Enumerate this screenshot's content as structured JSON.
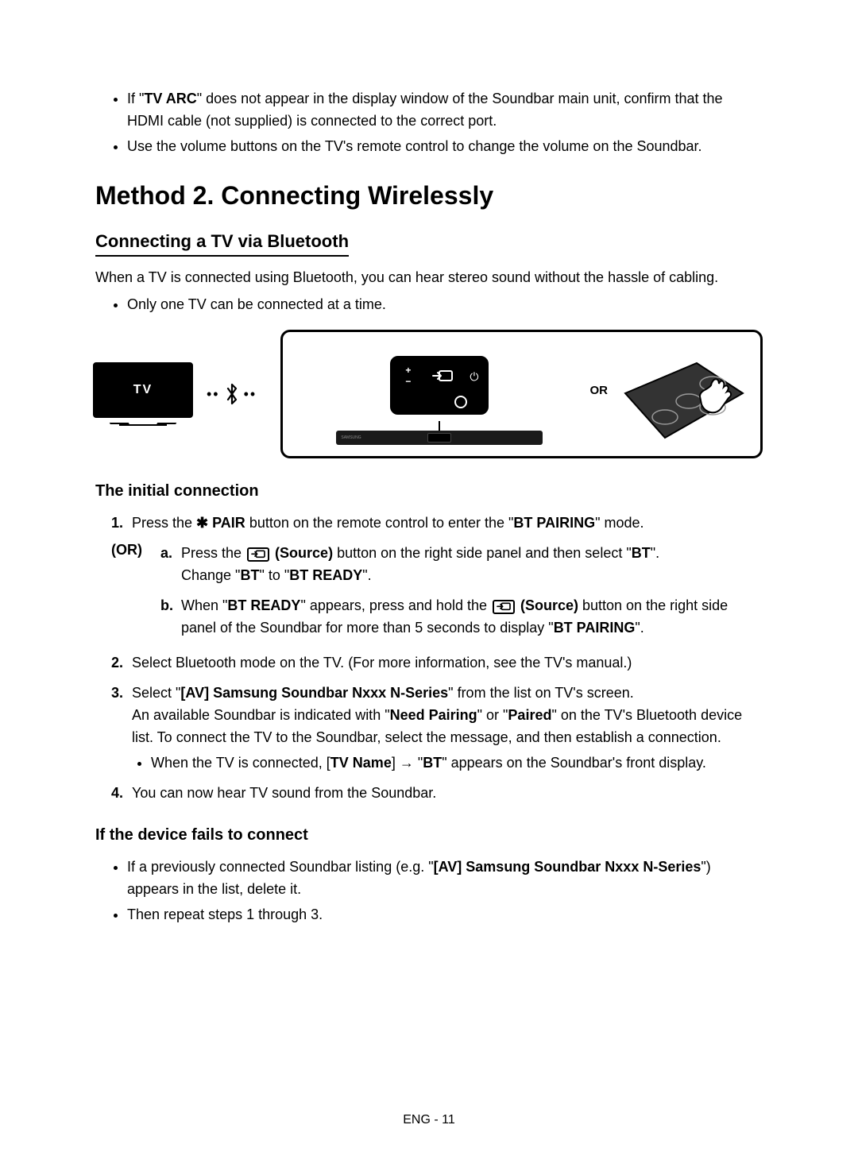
{
  "intro": {
    "bullets": [
      {
        "pre": "If \"",
        "bold": "TV ARC",
        "post": "\" does not appear in the display window of the Soundbar main unit, confirm that the HDMI cable (not supplied) is connected to the correct port."
      },
      {
        "plain": "Use the volume buttons on the TV's remote control to change the volume on the Soundbar."
      }
    ]
  },
  "method_heading": "Method 2. Connecting Wirelessly",
  "subheading": "Connecting a TV via Bluetooth",
  "desc": "When a TV is connected using Bluetooth, you can hear stereo sound without the hassle of cabling.",
  "desc_bullet": "Only one TV can be connected at a time.",
  "diagram": {
    "tv_label": "TV",
    "or_label": "OR",
    "soundbar_brand": "SAMSUNG",
    "remote_plus": "+",
    "remote_minus": "−",
    "remote_power": "⏻"
  },
  "initial_heading": "The initial connection",
  "step1": {
    "pre": "Press the ",
    "bt": "✱",
    "pair": " PAIR",
    "mid": " button on the remote control to enter the \"",
    "bold2": "BT PAIRING",
    "post": "\" mode."
  },
  "or_label": "(OR)",
  "step1a": {
    "marker": "a.",
    "pre": "Press the ",
    "src": " (Source)",
    "mid": " button on the right side panel and then select \"",
    "bold": "BT",
    "post": "\".",
    "line2_pre": "Change \"",
    "line2_b1": "BT",
    "line2_mid": "\" to \"",
    "line2_b2": "BT READY",
    "line2_post": "\"."
  },
  "step1b": {
    "marker": "b.",
    "pre": "When \"",
    "b1": "BT READY",
    "mid1": "\" appears, press and hold the ",
    "src": " (Source)",
    "mid2": " button on the right side panel of the Soundbar for more than 5 seconds to display \"",
    "b2": "BT PAIRING",
    "post": "\"."
  },
  "step2": "Select Bluetooth mode on the TV. (For more information, see the TV's manual.)",
  "step3": {
    "pre": "Select \"",
    "b1": "[AV] Samsung Soundbar Nxxx N-Series",
    "mid1": "\" from the list on TV's screen.",
    "line2_pre": "An available Soundbar is indicated with \"",
    "line2_b1": "Need Pairing",
    "line2_mid": "\" or \"",
    "line2_b2": "Paired",
    "line2_post": "\" on the TV's Bluetooth device list. To connect the TV to the Soundbar, select the message, and then establish a connection.",
    "sub_pre": "When the TV is connected, [",
    "sub_b1": "TV Name",
    "sub_mid": "] → \"",
    "sub_b2": "BT",
    "sub_post": "\" appears on the Soundbar's front display."
  },
  "step4": "You can now hear TV sound from the Soundbar.",
  "fails_heading": "If the device fails to connect",
  "fail_bullets": {
    "b1_pre": "If a previously connected Soundbar listing (e.g. \"",
    "b1_bold": "[AV] Samsung Soundbar Nxxx N-Series",
    "b1_post": "\") appears in the list, delete it.",
    "b2": "Then repeat steps 1 through 3."
  },
  "footer": "ENG - 11"
}
